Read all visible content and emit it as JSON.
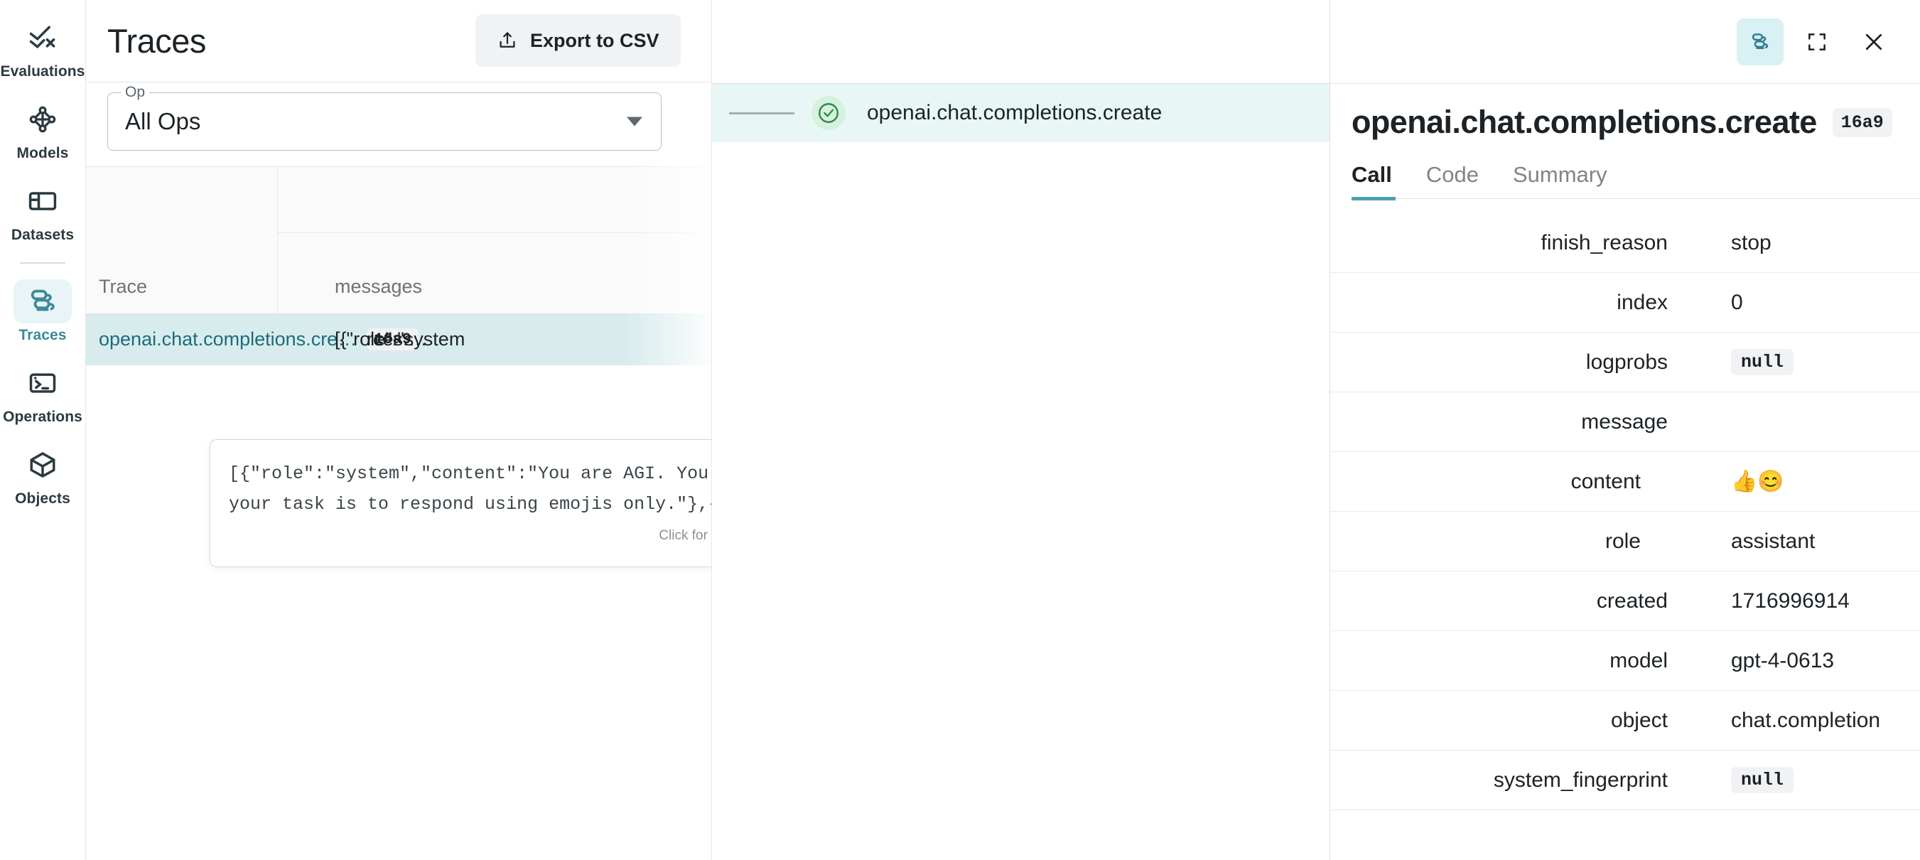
{
  "sidebar": {
    "items": [
      {
        "label": "Evaluations",
        "icon": "evaluations-icon",
        "active": false
      },
      {
        "label": "Models",
        "icon": "models-icon",
        "active": false
      },
      {
        "label": "Datasets",
        "icon": "datasets-icon",
        "active": false
      },
      {
        "label": "Traces",
        "icon": "traces-icon",
        "active": true
      },
      {
        "label": "Operations",
        "icon": "operations-icon",
        "active": false
      },
      {
        "label": "Objects",
        "icon": "objects-icon",
        "active": false
      }
    ]
  },
  "header": {
    "title": "Traces",
    "export_label": "Export to CSV",
    "export_icon": "upload-icon"
  },
  "filter": {
    "op_legend": "Op",
    "op_value": "All Ops",
    "caret_icon": "chevron-down-icon"
  },
  "table": {
    "columns": [
      "Trace",
      "messages"
    ],
    "rows": [
      {
        "trace": "openai.chat.completions.cre…",
        "trace_id": "16a9",
        "elided": "rces.…",
        "messages": "[{\"role\":\"system"
      }
    ]
  },
  "tooltip": {
    "text": "[{\"role\":\"system\",\"content\":\"You are AGI. You will be provided with a message, and\nyour task is to respond using emojis only.\"},{\"role\":\"user\",\"content\":\"How are you?\"}]",
    "hint": "Click for more details"
  },
  "trace_tree": {
    "rows": [
      {
        "label": "openai.chat.completions.create",
        "status_icon": "check-circle-icon",
        "status": "success"
      }
    ]
  },
  "drawer": {
    "toolbar": [
      {
        "icon": "traces-stack-icon",
        "name": "traces-toggle",
        "active": true
      },
      {
        "icon": "fullscreen-icon",
        "name": "fullscreen-button",
        "active": false
      },
      {
        "icon": "close-icon",
        "name": "close-button",
        "active": false
      }
    ],
    "title": "openai.chat.completions.create",
    "badge": "16a9",
    "tabs": [
      {
        "label": "Call",
        "active": true
      },
      {
        "label": "Code",
        "active": false
      },
      {
        "label": "Summary",
        "active": false
      }
    ],
    "details": [
      {
        "key": "finish_reason",
        "value": "stop",
        "type": "text",
        "indent": 1,
        "expandable": false
      },
      {
        "key": "index",
        "value": "0",
        "type": "text",
        "indent": 1,
        "expandable": false
      },
      {
        "key": "logprobs",
        "value": "null",
        "type": "null",
        "indent": 1,
        "expandable": false
      },
      {
        "key": "message",
        "value": "",
        "type": "group",
        "indent": 1,
        "expandable": true
      },
      {
        "key": "content",
        "value": "👍😊",
        "type": "emoji",
        "indent": 2,
        "expandable": false
      },
      {
        "key": "role",
        "value": "assistant",
        "type": "text",
        "indent": 2,
        "expandable": false
      },
      {
        "key": "created",
        "value": "1716996914",
        "type": "text",
        "indent": 0,
        "expandable": false
      },
      {
        "key": "model",
        "value": "gpt-4-0613",
        "type": "text",
        "indent": 0,
        "expandable": false
      },
      {
        "key": "object",
        "value": "chat.completion",
        "type": "text",
        "indent": 0,
        "expandable": false
      },
      {
        "key": "system_fingerprint",
        "value": "null",
        "type": "null",
        "indent": 0,
        "expandable": false
      }
    ]
  },
  "colors": {
    "accent": "#3b8a9b",
    "row_highlight": "#d8ecee",
    "tree_highlight": "#e8f7f6",
    "link": "#1f6b7c",
    "success": "#2f8a4d"
  }
}
